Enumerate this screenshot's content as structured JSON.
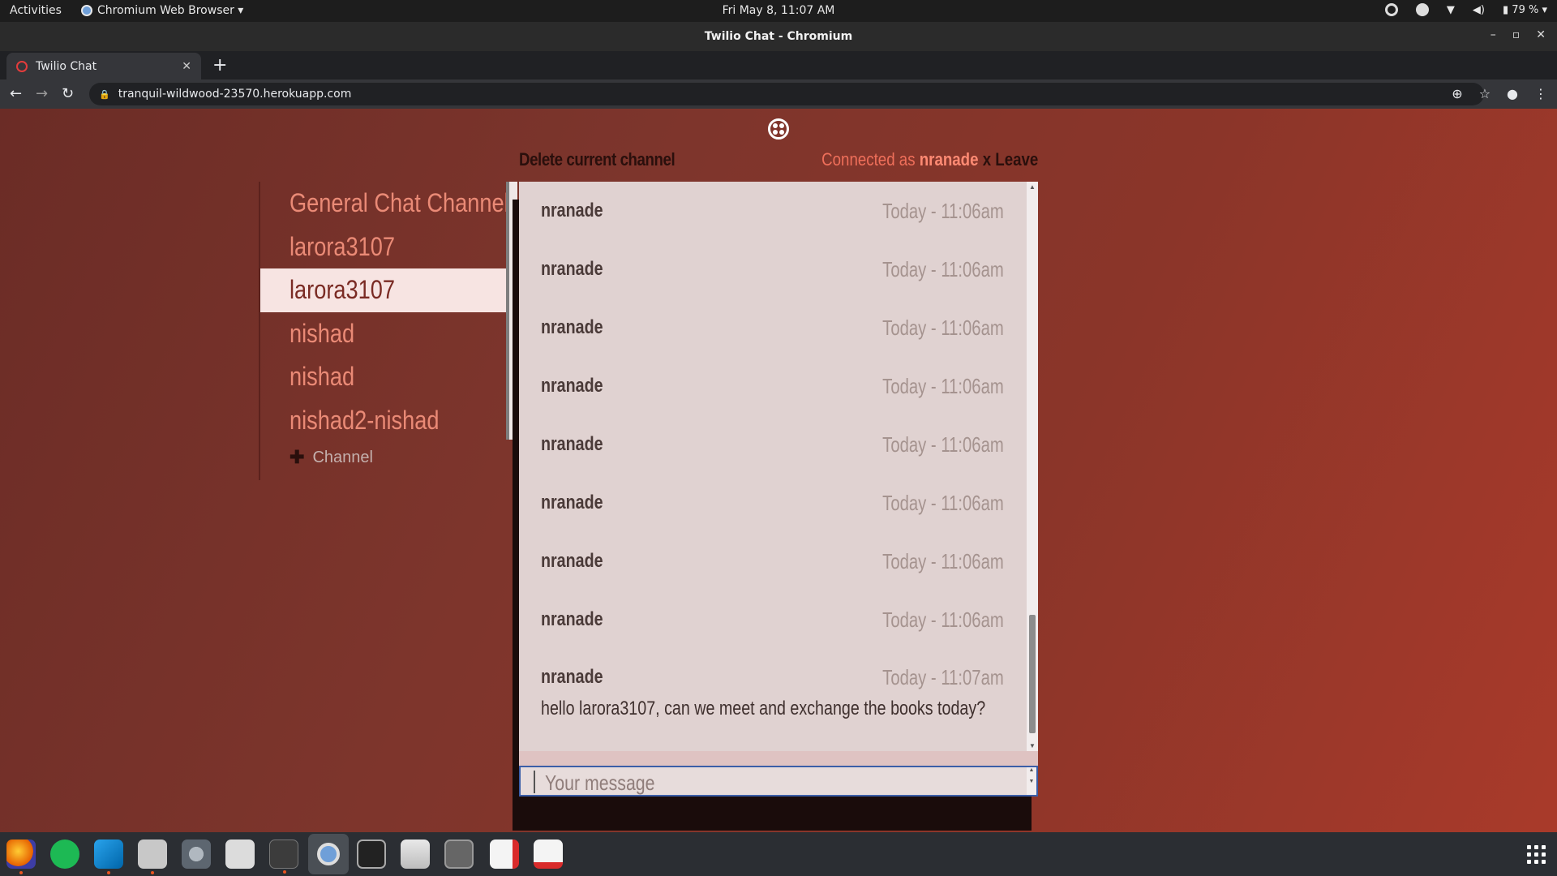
{
  "topbar": {
    "activities": "Activities",
    "app_menu": "Chromium Web Browser ▾",
    "clock": "Fri May  8, 11:07 AM",
    "battery": "79 %"
  },
  "window": {
    "title": "Twilio Chat - Chromium"
  },
  "tab": {
    "title": "Twilio Chat"
  },
  "omnibox": {
    "url": "tranquil-wildwood-23570.herokuapp.com"
  },
  "header": {
    "delete_channel": "Delete current channel",
    "connected_prefix": "Connected as ",
    "username": "nranade",
    "x_label": " x ",
    "leave": "Leave"
  },
  "channels": [
    {
      "name": "General Chat Channel",
      "active": false
    },
    {
      "name": "larora3107",
      "active": false
    },
    {
      "name": "larora3107",
      "active": true
    },
    {
      "name": "nishad",
      "active": false
    },
    {
      "name": "nishad",
      "active": false
    },
    {
      "name": "nishad2-nishad",
      "active": false
    }
  ],
  "add_channel": "Channel",
  "messages": [
    {
      "author": "nranade",
      "time": "Today - 11:06am"
    },
    {
      "author": "nranade",
      "time": "Today - 11:06am"
    },
    {
      "author": "nranade",
      "time": "Today - 11:06am"
    },
    {
      "author": "nranade",
      "time": "Today - 11:06am"
    },
    {
      "author": "nranade",
      "time": "Today - 11:06am"
    },
    {
      "author": "nranade",
      "time": "Today - 11:06am"
    },
    {
      "author": "nranade",
      "time": "Today - 11:06am"
    },
    {
      "author": "nranade",
      "time": "Today - 11:06am"
    },
    {
      "author": "nranade",
      "time": "Today - 11:07am",
      "body": "hello larora3107, can we meet and exchange the books today?"
    }
  ],
  "input": {
    "placeholder": "Your message"
  },
  "dock_apps": [
    "firefox-icon",
    "spotify-icon",
    "vscode-icon",
    "files-icon",
    "settings-icon",
    "toggle-icon",
    "terminal-icon",
    "chromium-icon",
    "system-monitor-icon",
    "software-icon",
    "screenshot-icon",
    "recorder-icon",
    "note-icon"
  ],
  "colors": {
    "page_bg": "#7d352c",
    "active_channel_bg": "#f7e4e2",
    "channel_text": "#ea8a76",
    "message_panel_bg": "#e0d2d1"
  }
}
